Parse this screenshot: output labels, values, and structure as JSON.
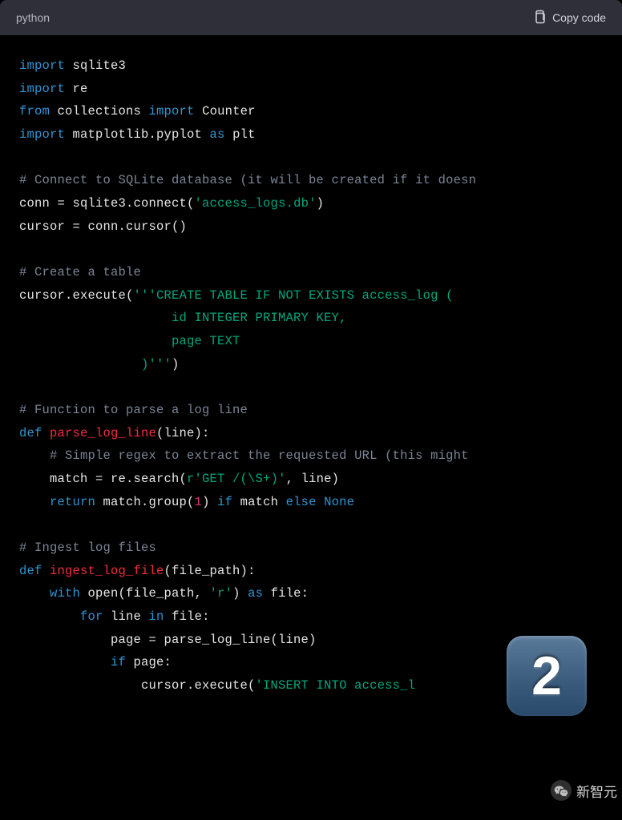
{
  "header": {
    "language": "python",
    "copy_label": "Copy code"
  },
  "code": {
    "l1_import": "import",
    "l1_mod": " sqlite3",
    "l2_import": "import",
    "l2_mod": " re",
    "l3_from": "from",
    "l3_mod1": " collections ",
    "l3_import": "import",
    "l3_mod2": " Counter",
    "l4_import": "import",
    "l4_mod": " matplotlib.pyplot ",
    "l4_as": "as",
    "l4_alias": " plt",
    "c1": "# Connect to SQLite database (it will be created if it doesn",
    "l6a": "conn = sqlite3.connect(",
    "l6s": "'access_logs.db'",
    "l6b": ")",
    "l7": "cursor = conn.cursor()",
    "c2": "# Create a table",
    "l9a": "cursor.execute(",
    "l9s1": "'''CREATE TABLE IF NOT EXISTS access_log (",
    "l10s": "                    id INTEGER PRIMARY KEY,",
    "l11s": "                    page TEXT",
    "l12s": "                )'''",
    "l12b": ")",
    "c3": "# Function to parse a log line",
    "l14_def": "def",
    "l14_fn": " parse_log_line",
    "l14_p": "(line):",
    "c4": "    # Simple regex to extract the requested URL (this might ",
    "l16a": "    match = re.search(",
    "l16s": "r'GET /(\\S+)'",
    "l16b": ", line)",
    "l17_ret": "    return",
    "l17a": " match.group(",
    "l17n": "1",
    "l17b": ") ",
    "l17_if": "if",
    "l17c": " match ",
    "l17_else": "else",
    "l17d": " None",
    "c5": "# Ingest log files",
    "l19_def": "def",
    "l19_fn": " ingest_log_file",
    "l19_p": "(file_path):",
    "l20_with": "    with",
    "l20a": " open(file_path, ",
    "l20s": "'r'",
    "l20b": ") ",
    "l20_as": "as",
    "l20c": " file:",
    "l21_for": "        for",
    "l21a": " line ",
    "l21_in": "in",
    "l21b": " file:",
    "l22": "            page = parse_log_line(line)",
    "l23_if": "            if",
    "l23a": " page:",
    "l24a": "                cursor.execute(",
    "l24s": "'INSERT INTO access_l"
  },
  "badge": {
    "number": "2"
  },
  "watermark": {
    "text": "新智元"
  }
}
